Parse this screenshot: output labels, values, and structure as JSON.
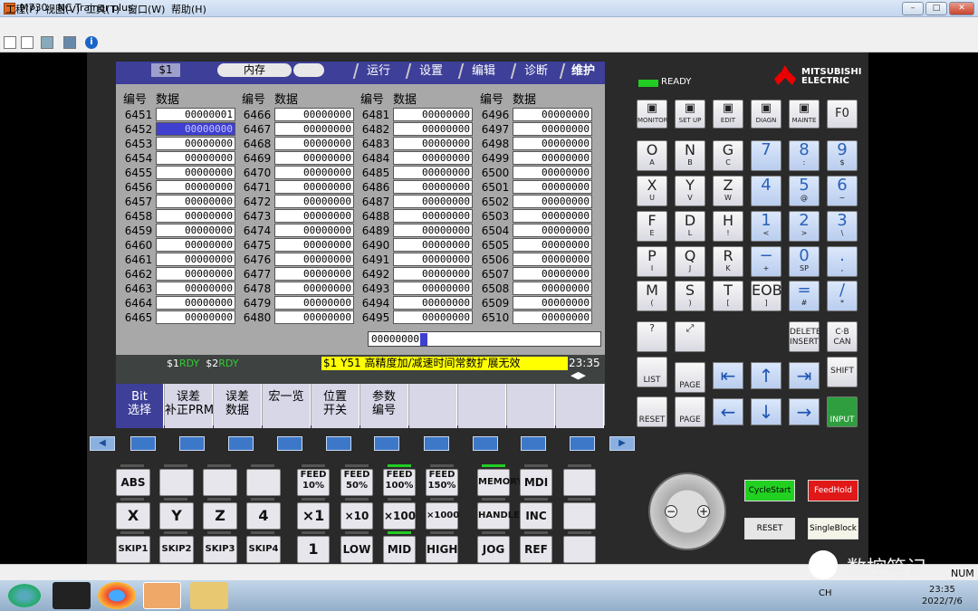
{
  "window": {
    "title": "M730 - NC Trainer plus",
    "buttons": [
      "–",
      "□",
      "✕"
    ]
  },
  "menu": [
    "工程(P)",
    "视图(V)",
    "工具(T)",
    "窗口(W)",
    "帮助(H)"
  ],
  "screen": {
    "channel": "$1",
    "mode": "内存",
    "tabs": [
      "运行",
      "设置",
      "编辑",
      "诊断",
      "维护"
    ],
    "col_head_no": "编号",
    "col_head_data": "数据",
    "columns": [
      {
        "nums": [
          "6451",
          "6452",
          "6453",
          "6454",
          "6455",
          "6456",
          "6457",
          "6458",
          "6459",
          "6460",
          "6461",
          "6462",
          "6463",
          "6464",
          "6465"
        ]
      },
      {
        "nums": [
          "6466",
          "6467",
          "6468",
          "6469",
          "6470",
          "6471",
          "6472",
          "6473",
          "6474",
          "6475",
          "6476",
          "6477",
          "6478",
          "6479",
          "6480"
        ]
      },
      {
        "nums": [
          "6481",
          "6482",
          "6483",
          "6484",
          "6485",
          "6486",
          "6487",
          "6488",
          "6489",
          "6490",
          "6491",
          "6492",
          "6493",
          "6494",
          "6495"
        ]
      },
      {
        "nums": [
          "6496",
          "6497",
          "6498",
          "6499",
          "6500",
          "6501",
          "6502",
          "6503",
          "6504",
          "6505",
          "6506",
          "6507",
          "6508",
          "6509",
          "6510"
        ]
      }
    ],
    "cell_value": "00000001",
    "default_value": "00000000",
    "input_value": "00000000",
    "status": {
      "s1": "$1",
      "s1_state": "RDY",
      "s2": "$2",
      "s2_state": "RDY"
    },
    "message": "$1    Y51   高精度加/减速时间常数扩展无效",
    "clock": "23:35",
    "softkeys": [
      "Bit\n选择",
      "误差\n补正PRM",
      "误差\n数据",
      "宏一览",
      "位置\n开关",
      "参数\n编号",
      "",
      "",
      "",
      ""
    ]
  },
  "left_keys": {
    "row1": [
      "ABS",
      "",
      "",
      "",
      "FEED\n10%",
      "FEED\n50%",
      "FEED\n100%",
      "FEED\n150%",
      "MEMORY",
      "MDI",
      ""
    ],
    "row2": [
      "X",
      "Y",
      "Z",
      "4",
      "×1",
      "×10",
      "×100",
      "×1000",
      "HANDLE",
      "INC",
      ""
    ],
    "row3": [
      "SKIP1",
      "SKIP2",
      "SKIP3",
      "SKIP4",
      "1",
      "LOW",
      "MID",
      "HIGH",
      "JOG",
      "REF",
      ""
    ]
  },
  "right": {
    "ready": "READY",
    "brand": "MITSUBISHI\nELECTRIC",
    "fn": [
      "MONITOR",
      "SET UP",
      "EDIT",
      "DIAGN",
      "MAINTE",
      "F0"
    ],
    "alpha": [
      [
        "O",
        "A"
      ],
      [
        "N",
        "B"
      ],
      [
        "G",
        "C"
      ],
      [
        "X",
        "U"
      ],
      [
        "Y",
        "V"
      ],
      [
        "Z",
        "W"
      ],
      [
        "F",
        "E"
      ],
      [
        "D",
        "L"
      ],
      [
        "H",
        "!"
      ],
      [
        "P",
        "I"
      ],
      [
        "Q",
        "J"
      ],
      [
        "R",
        "K"
      ],
      [
        "M",
        "("
      ],
      [
        "S",
        ")"
      ],
      [
        "T",
        "["
      ],
      [
        "EOB",
        "]"
      ]
    ],
    "num": [
      [
        "7",
        ""
      ],
      [
        "8",
        ":"
      ],
      [
        "9",
        "$"
      ],
      [
        "4",
        ""
      ],
      [
        "5",
        "@"
      ],
      [
        "6",
        "~"
      ],
      [
        "1",
        "<"
      ],
      [
        "2",
        ">"
      ],
      [
        "3",
        "\\"
      ],
      [
        "−",
        "+"
      ],
      [
        "0",
        "SP"
      ],
      [
        ".",
        ","
      ],
      [
        "=",
        "#"
      ],
      [
        "/",
        "*"
      ]
    ],
    "edit": [
      "DELETE\nINSERT",
      "C·B\nCAN",
      "SHIFT",
      "INPUT",
      "RESET",
      "LIST",
      "PAGE",
      "PAGE"
    ],
    "controls": [
      "CycleStart",
      "FeedHold",
      "RESET",
      "SingleBlock"
    ]
  },
  "statusbar": {
    "right": "NUM"
  },
  "taskbar": {
    "ime": "CH",
    "time": "23:35",
    "date": "2022/7/6"
  },
  "watermark": "数控笔记"
}
